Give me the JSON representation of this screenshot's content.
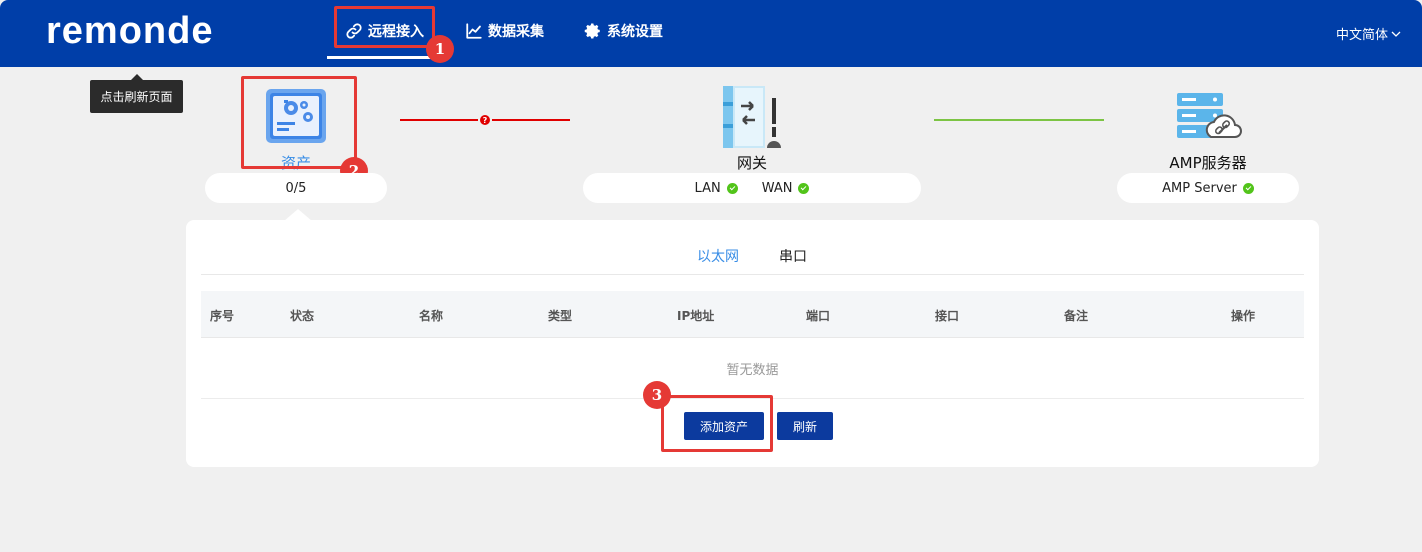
{
  "app": {
    "logo_text": "remonde"
  },
  "nav": {
    "items": [
      {
        "label": "远程接入",
        "icon": "link-icon",
        "active": true
      },
      {
        "label": "数据采集",
        "icon": "chart-line-icon",
        "active": false
      },
      {
        "label": "系统设置",
        "icon": "gear-icon",
        "active": false
      }
    ],
    "language": "中文简体"
  },
  "tooltip": {
    "text": "点击刷新页面"
  },
  "annotations": {
    "badge1": "1",
    "badge2": "2",
    "badge3": "3",
    "color": "#e53935"
  },
  "topology": {
    "asset": {
      "label": "资产",
      "count": "0/5",
      "icon": "asset-device-icon"
    },
    "gateway": {
      "label": "网关",
      "lan": "LAN",
      "wan": "WAN",
      "icon": "gateway-icon"
    },
    "server": {
      "label": "AMP服务器",
      "status": "AMP Server",
      "icon": "server-cloud-icon"
    },
    "link_asset_gateway": {
      "status": "error",
      "color": "#e00000"
    },
    "link_gateway_server": {
      "status": "ok",
      "color": "#7cc444"
    }
  },
  "tabs": [
    {
      "label": "以太网",
      "active": true
    },
    {
      "label": "串口",
      "active": false
    }
  ],
  "table": {
    "columns": [
      "序号",
      "状态",
      "名称",
      "类型",
      "IP地址",
      "端口",
      "接口",
      "备注",
      "操作"
    ],
    "empty_text": "暂无数据"
  },
  "buttons": {
    "add_asset": "添加资产",
    "refresh": "刷新"
  },
  "colors": {
    "brand": "#003ea8",
    "button": "#0c3a9e",
    "accent_text": "#3a8ee6",
    "ok": "#52c41a"
  }
}
